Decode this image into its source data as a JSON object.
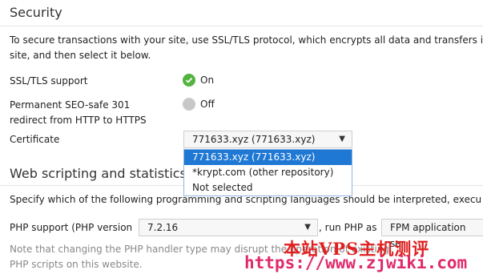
{
  "security": {
    "title": "Security",
    "description_line1": "To secure transactions with your site, use SSL/TLS protocol, which encrypts all data and transfers i",
    "description_line2": "site, and then select it below.",
    "ssl_label": "SSL/TLS support",
    "ssl_status": "On",
    "redirect_label_line1": "Permanent SEO-safe 301",
    "redirect_label_line2": "redirect from HTTP to HTTPS",
    "redirect_status": "Off",
    "certificate_label": "Certificate",
    "certificate_selected": "771633.xyz (771633.xyz)",
    "certificate_options": [
      "771633.xyz (771633.xyz)",
      "*krypt.com (other repository)",
      "Not selected"
    ]
  },
  "web_scripting": {
    "title": "Web scripting and statistics",
    "description": "Specify which of the following programming and scripting languages should be interpreted, execu",
    "php_label": "PHP support (PHP version",
    "php_version": "7.2.16",
    "run_php_as_label": ", run PHP as",
    "php_handler": "FPM application ser",
    "note_line1": "Note that changing the PHP handler type may disrupt the operation of existing",
    "note_line2": "PHP scripts on this website."
  },
  "watermark": {
    "cn": "本站VPS主机测评",
    "url": "https://www.zjwiki.com"
  },
  "colors": {
    "on": "#53b33f",
    "off": "#c8c8c8",
    "selected_option": "#1e78d4",
    "watermark_cn": "#e02020",
    "watermark_url": "#e02a6b"
  }
}
